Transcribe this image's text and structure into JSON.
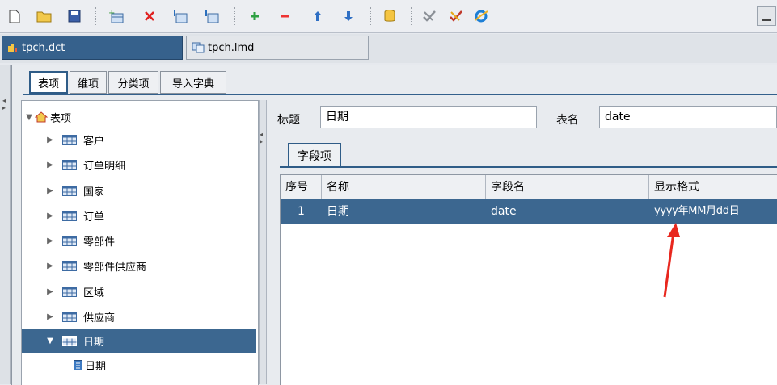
{
  "toolbar": {
    "icons": [
      "new-file-icon",
      "open-folder-icon",
      "save-icon",
      "add-table-icon",
      "delete-icon",
      "import-table-icon",
      "export-table-icon",
      "add-row-icon",
      "remove-row-icon",
      "move-up-icon",
      "move-down-icon",
      "database-icon",
      "check-icon",
      "tool-icon",
      "browser-icon"
    ]
  },
  "file_tabs": [
    {
      "label": "tpch.dct",
      "active": true
    },
    {
      "label": "tpch.lmd",
      "active": false
    }
  ],
  "panel_tabs": [
    "表项",
    "维项",
    "分类项",
    "导入字典"
  ],
  "tree": {
    "root": "表项",
    "items": [
      "客户",
      "订单明细",
      "国家",
      "订单",
      "零部件",
      "零部件供应商",
      "区域",
      "供应商",
      "日期"
    ],
    "selected": "日期",
    "child": "日期"
  },
  "form": {
    "title_label": "标题",
    "title_value": "日期",
    "table_name_label": "表名",
    "table_name_value": "date"
  },
  "sub_tab": "字段项",
  "grid": {
    "headers": [
      "序号",
      "名称",
      "字段名",
      "显示格式"
    ],
    "rows": [
      {
        "no": "1",
        "name": "日期",
        "field": "date",
        "format": "yyyy年MM月dd日"
      }
    ]
  },
  "colors": {
    "selection": "#3c6790",
    "accent": "#2f5c87",
    "annotation_arrow": "#e8271e"
  }
}
